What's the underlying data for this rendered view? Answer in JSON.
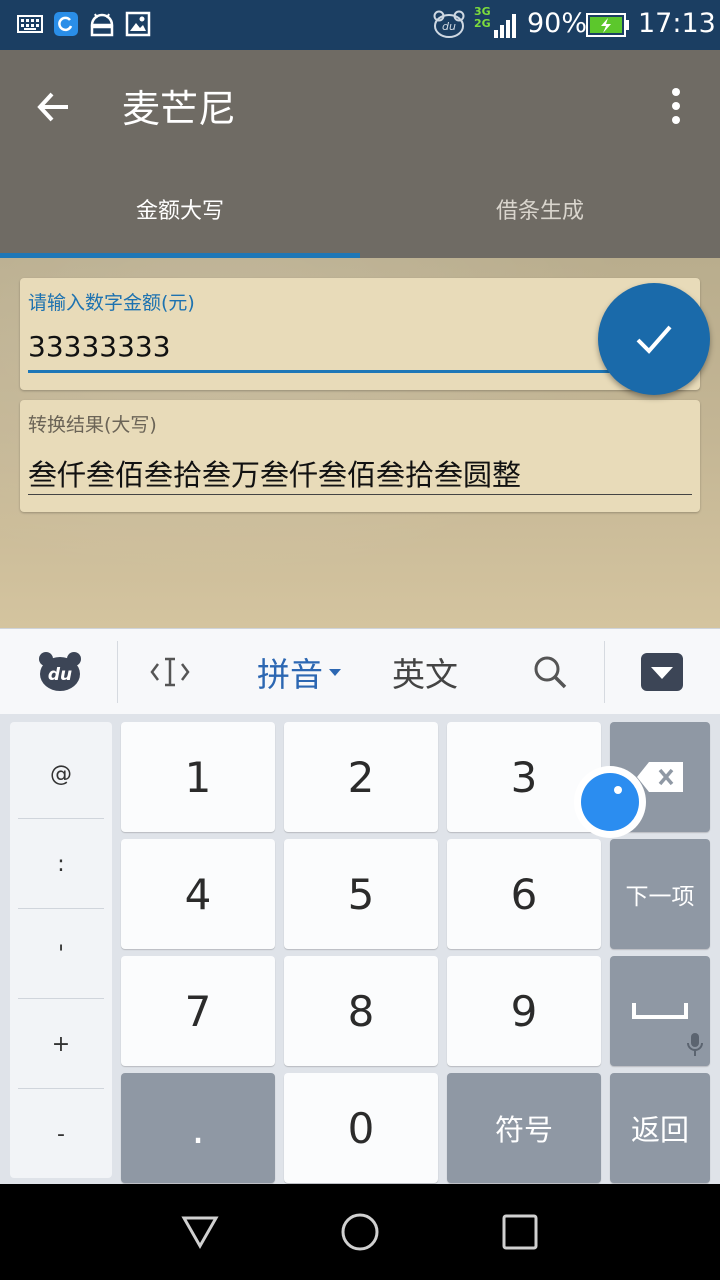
{
  "status_bar": {
    "icons": [
      "keyboard-icon",
      "sync-app-icon",
      "android-icon",
      "image-icon",
      "du-bear-icon"
    ],
    "network_top": "3G",
    "network_bottom": "2G",
    "battery": "90%",
    "time": "17:13"
  },
  "app_bar": {
    "title": "麦芒尼",
    "back_icon": "arrow-left-icon",
    "menu_icon": "more-vert-icon"
  },
  "tabs": [
    {
      "label": "金额大写",
      "active": true
    },
    {
      "label": "借条生成",
      "active": false
    }
  ],
  "amount_field": {
    "label": "请输入数字金额(元)",
    "value": "33333333"
  },
  "result_field": {
    "label": "转换结果(大写)",
    "value": "叁仟叁佰叁拾叁万叁仟叁佰叁拾叁圆整"
  },
  "fab": {
    "icon": "check-icon"
  },
  "keyboard_toolbar": {
    "logo": "du-logo-icon",
    "cursor_icon": "cursor-move-icon",
    "pinyin_label": "拼音",
    "english_label": "英文",
    "search_icon": "search-icon",
    "hide_icon": "keyboard-hide-icon"
  },
  "symbols": [
    "@",
    ":",
    "'",
    "+",
    "-"
  ],
  "keys": {
    "row1": [
      "1",
      "2",
      "3"
    ],
    "row2": [
      "4",
      "5",
      "6"
    ],
    "row3": [
      "7",
      "8",
      "9"
    ],
    "dot": ".",
    "zero": "0",
    "symbols_label": "符号",
    "next_label": "下一项",
    "return_label": "返回"
  },
  "colors": {
    "accent": "#1e77b7",
    "app_bar": "#6f6b64",
    "status_bar": "#1b3e62",
    "card": "#e8dbb9",
    "key_gray": "#8f98a4"
  }
}
